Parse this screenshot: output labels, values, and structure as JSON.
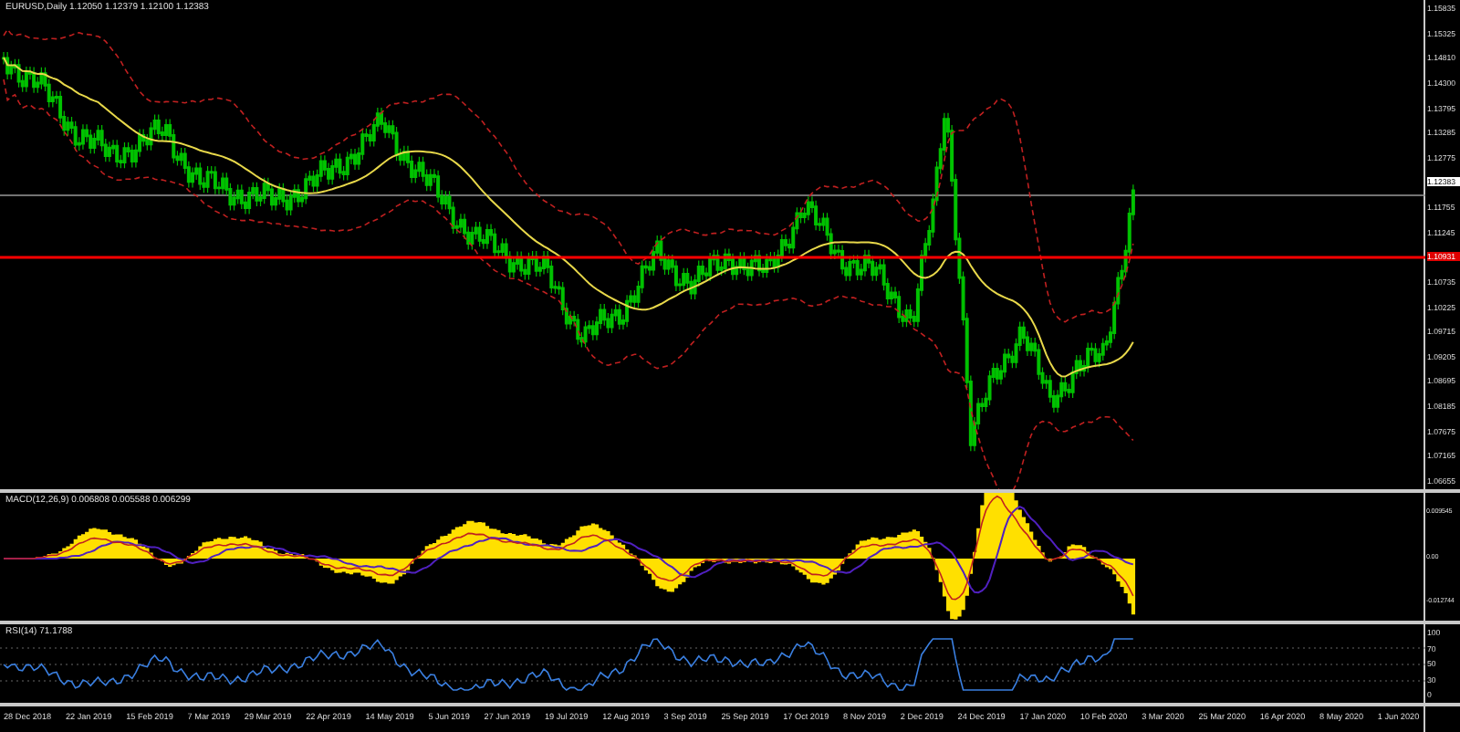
{
  "main_chart": {
    "title": "EURUSD,Daily  1.12050 1.12379 1.12100 1.12383",
    "price_axis": [
      {
        "label": "1.15835",
        "kind": "tick"
      },
      {
        "label": "1.15325",
        "kind": "tick"
      },
      {
        "label": "1.14810",
        "kind": "tick"
      },
      {
        "label": "1.14300",
        "kind": "tick"
      },
      {
        "label": "1.13795",
        "kind": "tick"
      },
      {
        "label": "1.13285",
        "kind": "tick"
      },
      {
        "label": "1.12775",
        "kind": "tick"
      },
      {
        "label": "1.12383",
        "kind": "current"
      },
      {
        "label": "1.11755",
        "kind": "tick"
      },
      {
        "label": "1.11245",
        "kind": "tick"
      },
      {
        "label": "1.10931",
        "kind": "level"
      },
      {
        "label": "1.10735",
        "kind": "tick"
      },
      {
        "label": "1.10225",
        "kind": "tick"
      },
      {
        "label": "1.09715",
        "kind": "tick"
      },
      {
        "label": "1.09205",
        "kind": "tick"
      },
      {
        "label": "1.08695",
        "kind": "tick"
      },
      {
        "label": "1.08185",
        "kind": "tick"
      },
      {
        "label": "1.07675",
        "kind": "tick"
      },
      {
        "label": "1.07165",
        "kind": "tick"
      },
      {
        "label": "1.06655",
        "kind": "tick"
      }
    ]
  },
  "macd_pane": {
    "title": "MACD(12,26,9) 0.006808 0.005588 0.006299",
    "axis": [
      "0.009545",
      "0.00",
      "-0.012744"
    ]
  },
  "rsi_pane": {
    "title": "RSI(14) 71.1788",
    "axis": [
      "100",
      "70",
      "50",
      "30",
      "0"
    ]
  },
  "time_axis": [
    "28 Dec 2018",
    "22 Jan 2019",
    "15 Feb 2019",
    "7 Mar 2019",
    "29 Mar 2019",
    "22 Apr 2019",
    "14 May 2019",
    "5 Jun 2019",
    "27 Jun 2019",
    "19 Jul 2019",
    "12 Aug 2019",
    "3 Sep 2019",
    "25 Sep 2019",
    "17 Oct 2019",
    "8 Nov 2019",
    "2 Dec 2019",
    "24 Dec 2019",
    "17 Jan 2020",
    "10 Feb 2020",
    "3 Mar 2020",
    "25 Mar 2020",
    "16 Apr 2020",
    "8 May 2020",
    "1 Jun 2020"
  ]
}
